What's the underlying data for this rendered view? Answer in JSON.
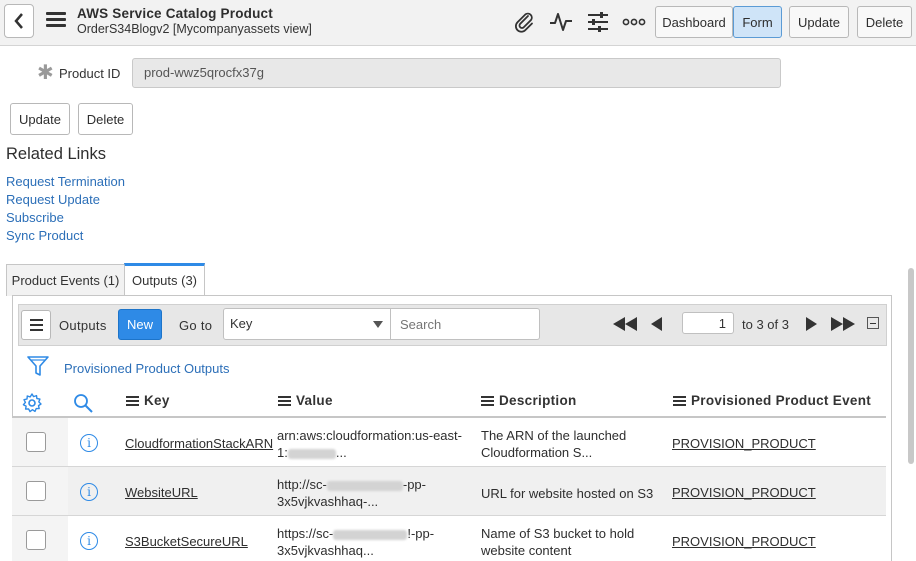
{
  "header": {
    "title": "AWS Service Catalog Product",
    "subtitle": "OrderS34Blogv2 [Mycompanyassets view]",
    "buttons": {
      "dashboard": "Dashboard",
      "form": "Form",
      "update": "Update",
      "delete": "Delete"
    },
    "icons": [
      "back-icon",
      "menu-icon",
      "attachment-icon",
      "activity-icon",
      "settings-sliders-icon",
      "more-icon"
    ]
  },
  "form": {
    "product_id_label": "Product ID",
    "product_id_value": "prod-wwz5qrocfx37g",
    "update_label": "Update",
    "delete_label": "Delete"
  },
  "related": {
    "title": "Related Links",
    "links": [
      "Request Termination",
      "Request Update",
      "Subscribe",
      "Sync Product"
    ]
  },
  "tabs": [
    {
      "label": "Product Events (1)",
      "active": false
    },
    {
      "label": "Outputs (3)",
      "active": true
    }
  ],
  "list": {
    "title": "Outputs",
    "new_label": "New",
    "goto_label": "Go to",
    "goto_field": "Key",
    "search_placeholder": "Search",
    "page_value": "1",
    "page_text": "to 3 of 3",
    "breadcrumb": "Provisioned Product Outputs",
    "columns": [
      "Key",
      "Value",
      "Description",
      "Provisioned Product Event"
    ],
    "rows": [
      {
        "key": "CloudformationStackARN",
        "value_line1": "arn:aws:cloudformation:us-east-",
        "value_line2a": "1:",
        "value_line2b": "...",
        "description_line1": "The ARN of the launched",
        "description_line2": "Cloudformation S...",
        "event": "PROVISION_PRODUCT"
      },
      {
        "key": "WebsiteURL",
        "value_line1a": "http://sc-",
        "value_line1b": "-pp-",
        "value_line2": "3x5vjkvashhaq-...",
        "description_line1": "URL for website hosted on S3",
        "event": "PROVISION_PRODUCT"
      },
      {
        "key": "S3BucketSecureURL",
        "value_line1a": "https://sc-",
        "value_line1b": "!-pp-",
        "value_line2": "3x5vjkvashhaq...",
        "description_line1": "Name of S3 bucket to hold",
        "description_line2": "website content",
        "event": "PROVISION_PRODUCT"
      }
    ]
  },
  "colors": {
    "accent": "#2e8ae6",
    "link": "#2c6fb8",
    "header_bg": "#f2f2f2"
  }
}
